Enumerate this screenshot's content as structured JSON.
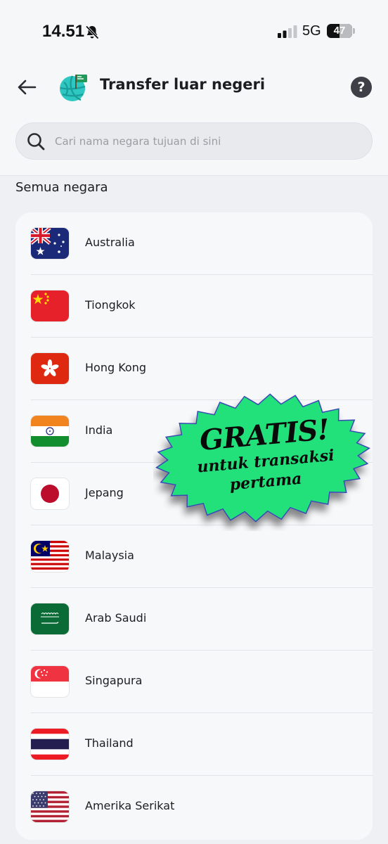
{
  "status_bar": {
    "time": "14.51",
    "network": "5G",
    "battery": "47"
  },
  "header": {
    "title": "Transfer luar negeri",
    "help_label": "?"
  },
  "search": {
    "placeholder": "Cari nama negara tujuan di sini"
  },
  "section": {
    "title": "Semua negara"
  },
  "countries": [
    {
      "name": "Australia",
      "flag": "australia-flag"
    },
    {
      "name": "Tiongkok",
      "flag": "china-flag"
    },
    {
      "name": "Hong Kong",
      "flag": "hong-kong-flag"
    },
    {
      "name": "India",
      "flag": "india-flag"
    },
    {
      "name": "Jepang",
      "flag": "japan-flag"
    },
    {
      "name": "Malaysia",
      "flag": "malaysia-flag"
    },
    {
      "name": "Arab Saudi",
      "flag": "saudi-arabia-flag"
    },
    {
      "name": "Singapura",
      "flag": "singapore-flag"
    },
    {
      "name": "Thailand",
      "flag": "thailand-flag"
    },
    {
      "name": "Amerika Serikat",
      "flag": "usa-flag"
    }
  ],
  "promo": {
    "headline": "GRATIS!",
    "line1": "untuk transaksi",
    "line2": "pertama",
    "color": "#22e07a"
  }
}
